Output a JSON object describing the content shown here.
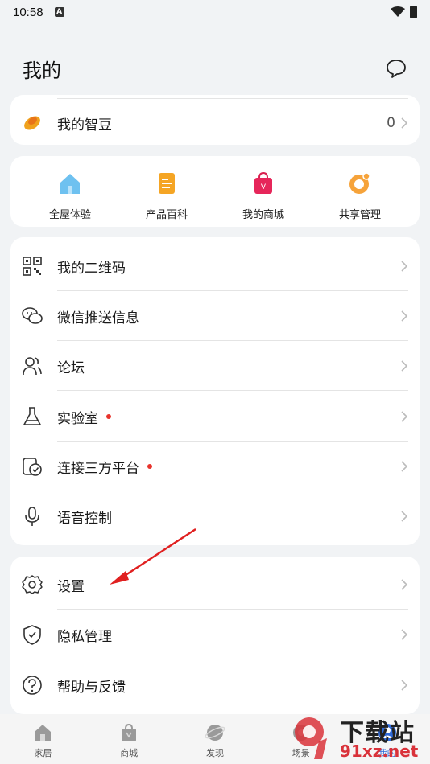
{
  "status_bar": {
    "time": "10:58",
    "notif_letter": "A"
  },
  "header": {
    "title": "我的"
  },
  "zhidou": {
    "label": "我的智豆",
    "value": "0"
  },
  "quick_links": [
    {
      "label": "全屋体验",
      "icon": "house-icon"
    },
    {
      "label": "产品百科",
      "icon": "product-book-icon"
    },
    {
      "label": "我的商城",
      "icon": "shopping-bag-icon"
    },
    {
      "label": "共享管理",
      "icon": "share-manage-icon"
    }
  ],
  "menu": [
    {
      "label": "我的二维码",
      "icon": "qr-code-icon",
      "dot": false
    },
    {
      "label": "微信推送信息",
      "icon": "wechat-icon",
      "dot": false
    },
    {
      "label": "论坛",
      "icon": "forum-users-icon",
      "dot": false
    },
    {
      "label": "实验室",
      "icon": "flask-icon",
      "dot": true
    },
    {
      "label": "连接三方平台",
      "icon": "third-party-icon",
      "dot": true
    },
    {
      "label": "语音控制",
      "icon": "microphone-icon",
      "dot": false
    }
  ],
  "settings_menu": [
    {
      "label": "设置",
      "icon": "gear-icon"
    },
    {
      "label": "隐私管理",
      "icon": "shield-icon"
    },
    {
      "label": "帮助与反馈",
      "icon": "help-icon"
    }
  ],
  "tabs": [
    {
      "label": "家居",
      "icon": "home-tab-icon"
    },
    {
      "label": "商城",
      "icon": "mall-tab-icon"
    },
    {
      "label": "发现",
      "icon": "discover-tab-icon"
    },
    {
      "label": "场景",
      "icon": "scene-tab-icon"
    },
    {
      "label": "我的",
      "icon": "me-tab-icon"
    }
  ],
  "watermark": {
    "brand": "下载站",
    "domain": "91xz.net"
  },
  "colors": {
    "accent_dot": "#e8332c",
    "annotation": "#e02020",
    "background": "#f1f3f5"
  }
}
